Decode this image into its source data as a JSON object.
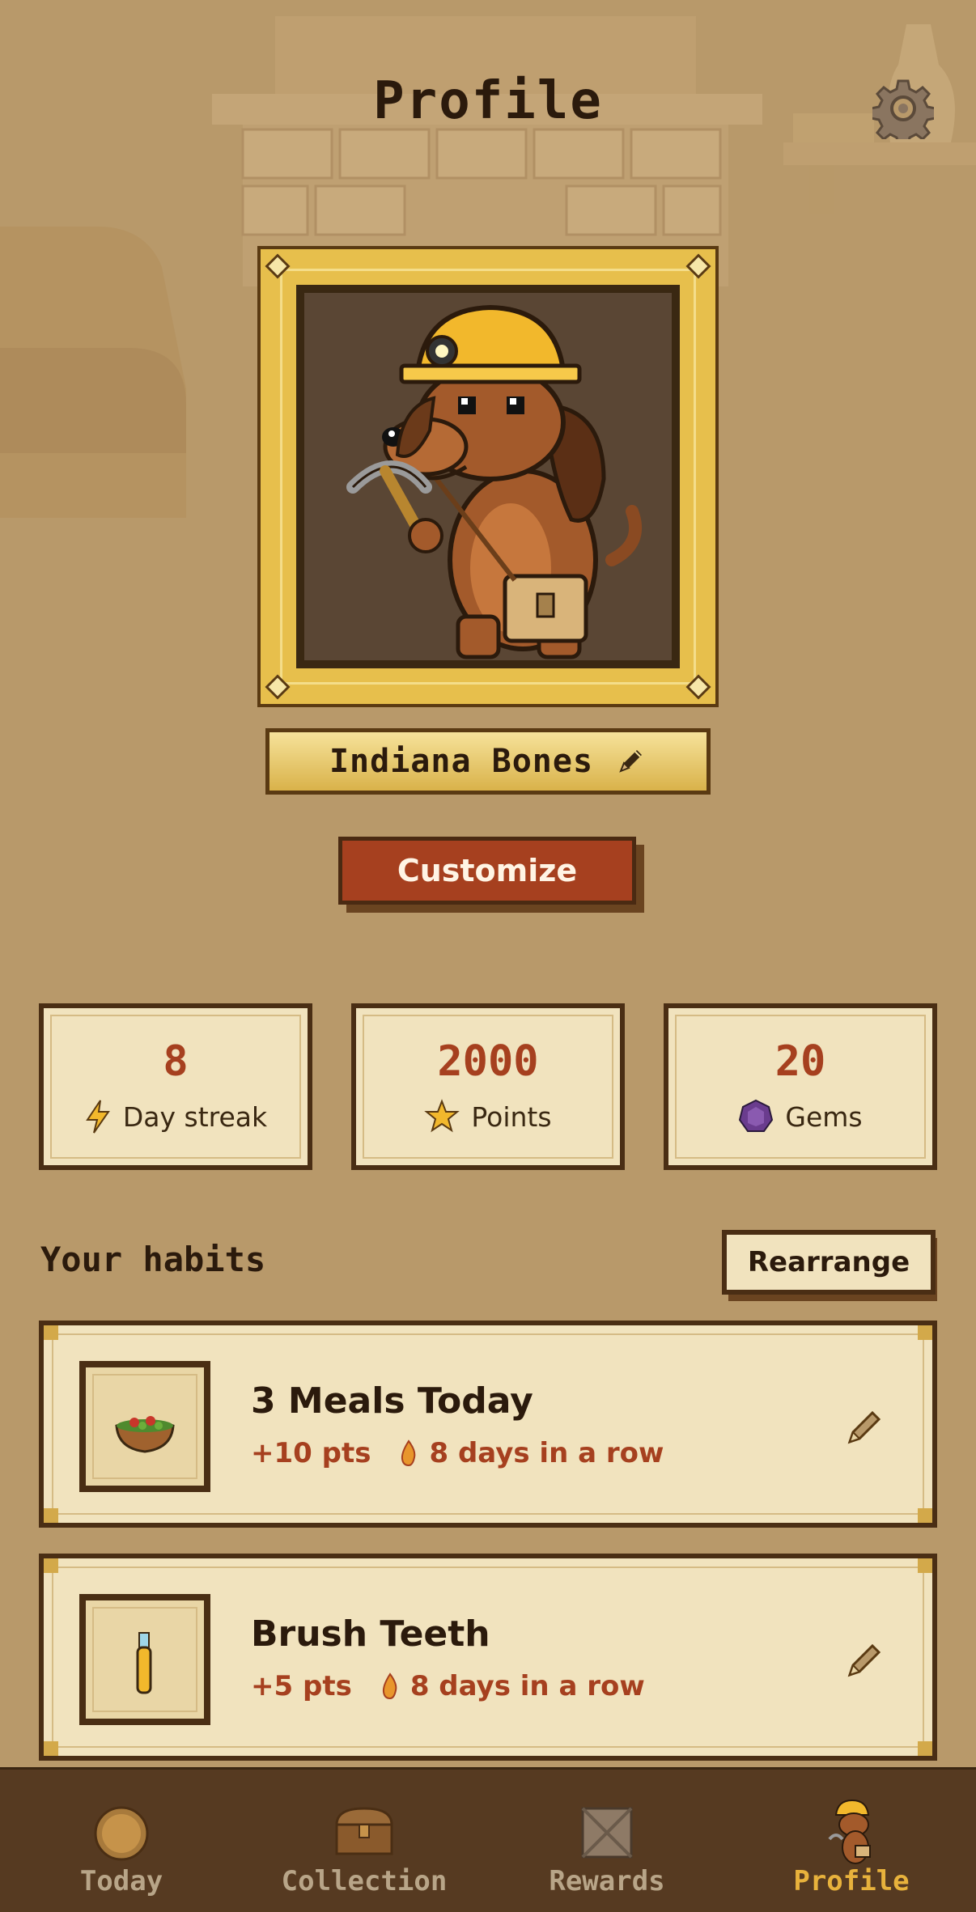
{
  "header": {
    "title": "Profile"
  },
  "profile": {
    "name": "Indiana Bones",
    "customize_label": "Customize"
  },
  "stats": [
    {
      "value": "8",
      "label": "Day streak",
      "icon": "lightning-icon"
    },
    {
      "value": "2000",
      "label": "Points",
      "icon": "star-icon"
    },
    {
      "value": "20",
      "label": "Gems",
      "icon": "gem-icon"
    }
  ],
  "habits_section": {
    "title": "Your habits",
    "rearrange_label": "Rearrange",
    "items": [
      {
        "title": "3 Meals Today",
        "points": "+10 pts",
        "streak": "8 days in a row",
        "icon": "salad-bowl-icon"
      },
      {
        "title": "Brush Teeth",
        "points": "+5 pts",
        "streak": "8 days in a row",
        "icon": "toothbrush-icon"
      }
    ]
  },
  "tabbar": {
    "tabs": [
      {
        "label": "Today",
        "icon": "coin-icon",
        "active": false
      },
      {
        "label": "Collection",
        "icon": "treasure-chest-icon",
        "active": false
      },
      {
        "label": "Rewards",
        "icon": "crate-icon",
        "active": false
      },
      {
        "label": "Profile",
        "icon": "dog-avatar-icon",
        "active": true
      }
    ]
  },
  "colors": {
    "background": "#b8996a",
    "accent_red": "#a6401f",
    "frame_gold": "#e7bf4c",
    "dark_brown": "#4a2e14",
    "tab_active": "#e8b23c"
  }
}
